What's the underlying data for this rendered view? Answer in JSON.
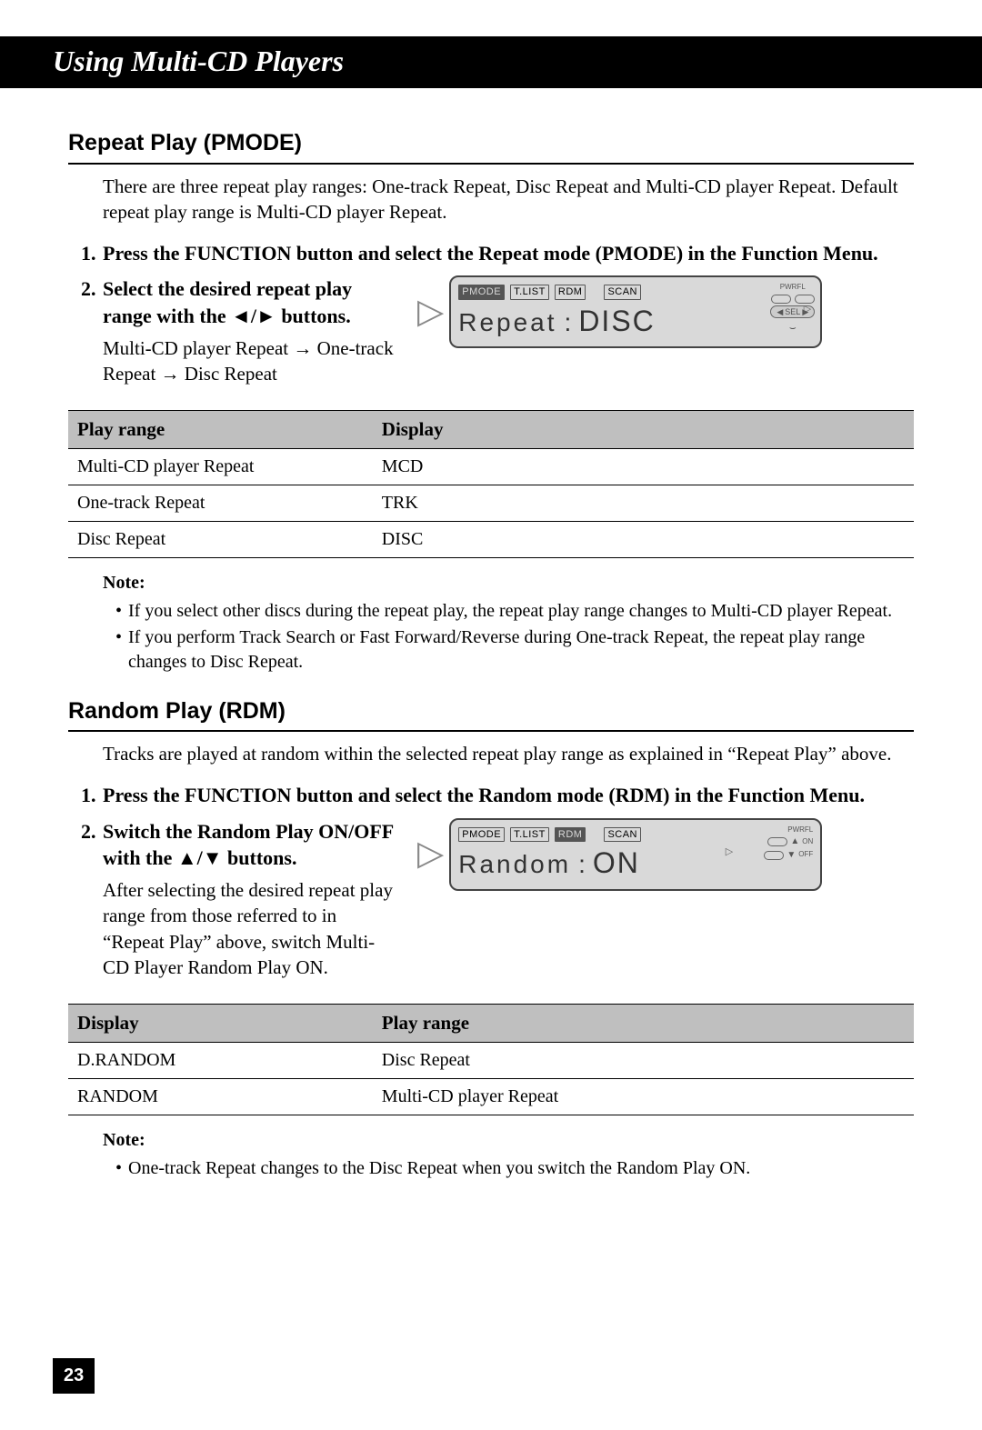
{
  "header_title": "Using Multi-CD Players",
  "section1": {
    "heading": "Repeat Play (PMODE)",
    "intro": "There are three repeat play ranges: One-track Repeat, Disc Repeat and Multi-CD player Repeat. Default repeat play range is Multi-CD player Repeat.",
    "step1": "Press the FUNCTION button and select the Repeat mode (PMODE) in the Function Menu.",
    "step2_head": "Select the desired repeat play range with the ◄/► buttons.",
    "step2_body": "Multi-CD player Repeat → One-track Repeat → Disc Repeat",
    "lcd": {
      "chips": [
        "PMODE",
        "T.LIST",
        "RDM",
        "SCAN"
      ],
      "label": "Repeat",
      "value": "DISC",
      "pwrfl": "PWRFL",
      "sel": "SEL"
    },
    "table": {
      "headers": [
        "Play range",
        "Display"
      ],
      "rows": [
        [
          "Multi-CD player Repeat",
          "MCD"
        ],
        [
          "One-track Repeat",
          "TRK"
        ],
        [
          "Disc Repeat",
          "DISC"
        ]
      ]
    },
    "note_label": "Note:",
    "notes": [
      "If you select other discs during the repeat play, the repeat play range changes to Multi-CD player Repeat.",
      "If you perform Track Search or Fast Forward/Reverse during One-track Repeat, the repeat play range changes to Disc Repeat."
    ]
  },
  "section2": {
    "heading": "Random Play (RDM)",
    "intro": "Tracks are played at random within the selected repeat play range as explained in “Repeat Play” above.",
    "step1": "Press the FUNCTION button and select the Random mode (RDM) in the Function Menu.",
    "step2_head": "Switch the Random Play ON/OFF with the ▲/▼ buttons.",
    "step2_body": "After selecting the desired repeat play range from those referred to in “Repeat Play” above, switch Multi-CD Player Random Play ON.",
    "lcd": {
      "chips": [
        "PMODE",
        "T.LIST",
        "RDM",
        "SCAN"
      ],
      "label": "Random",
      "value": "ON",
      "pwrfl": "PWRFL",
      "on": "ON",
      "off": "OFF"
    },
    "table": {
      "headers": [
        "Display",
        "Play range"
      ],
      "rows": [
        [
          "D.RANDOM",
          "Disc Repeat"
        ],
        [
          "RANDOM",
          "Multi-CD player Repeat"
        ]
      ]
    },
    "note_label": "Note:",
    "notes": [
      "One-track Repeat changes to the Disc Repeat when you switch the Random Play ON."
    ]
  },
  "page_number": "23"
}
